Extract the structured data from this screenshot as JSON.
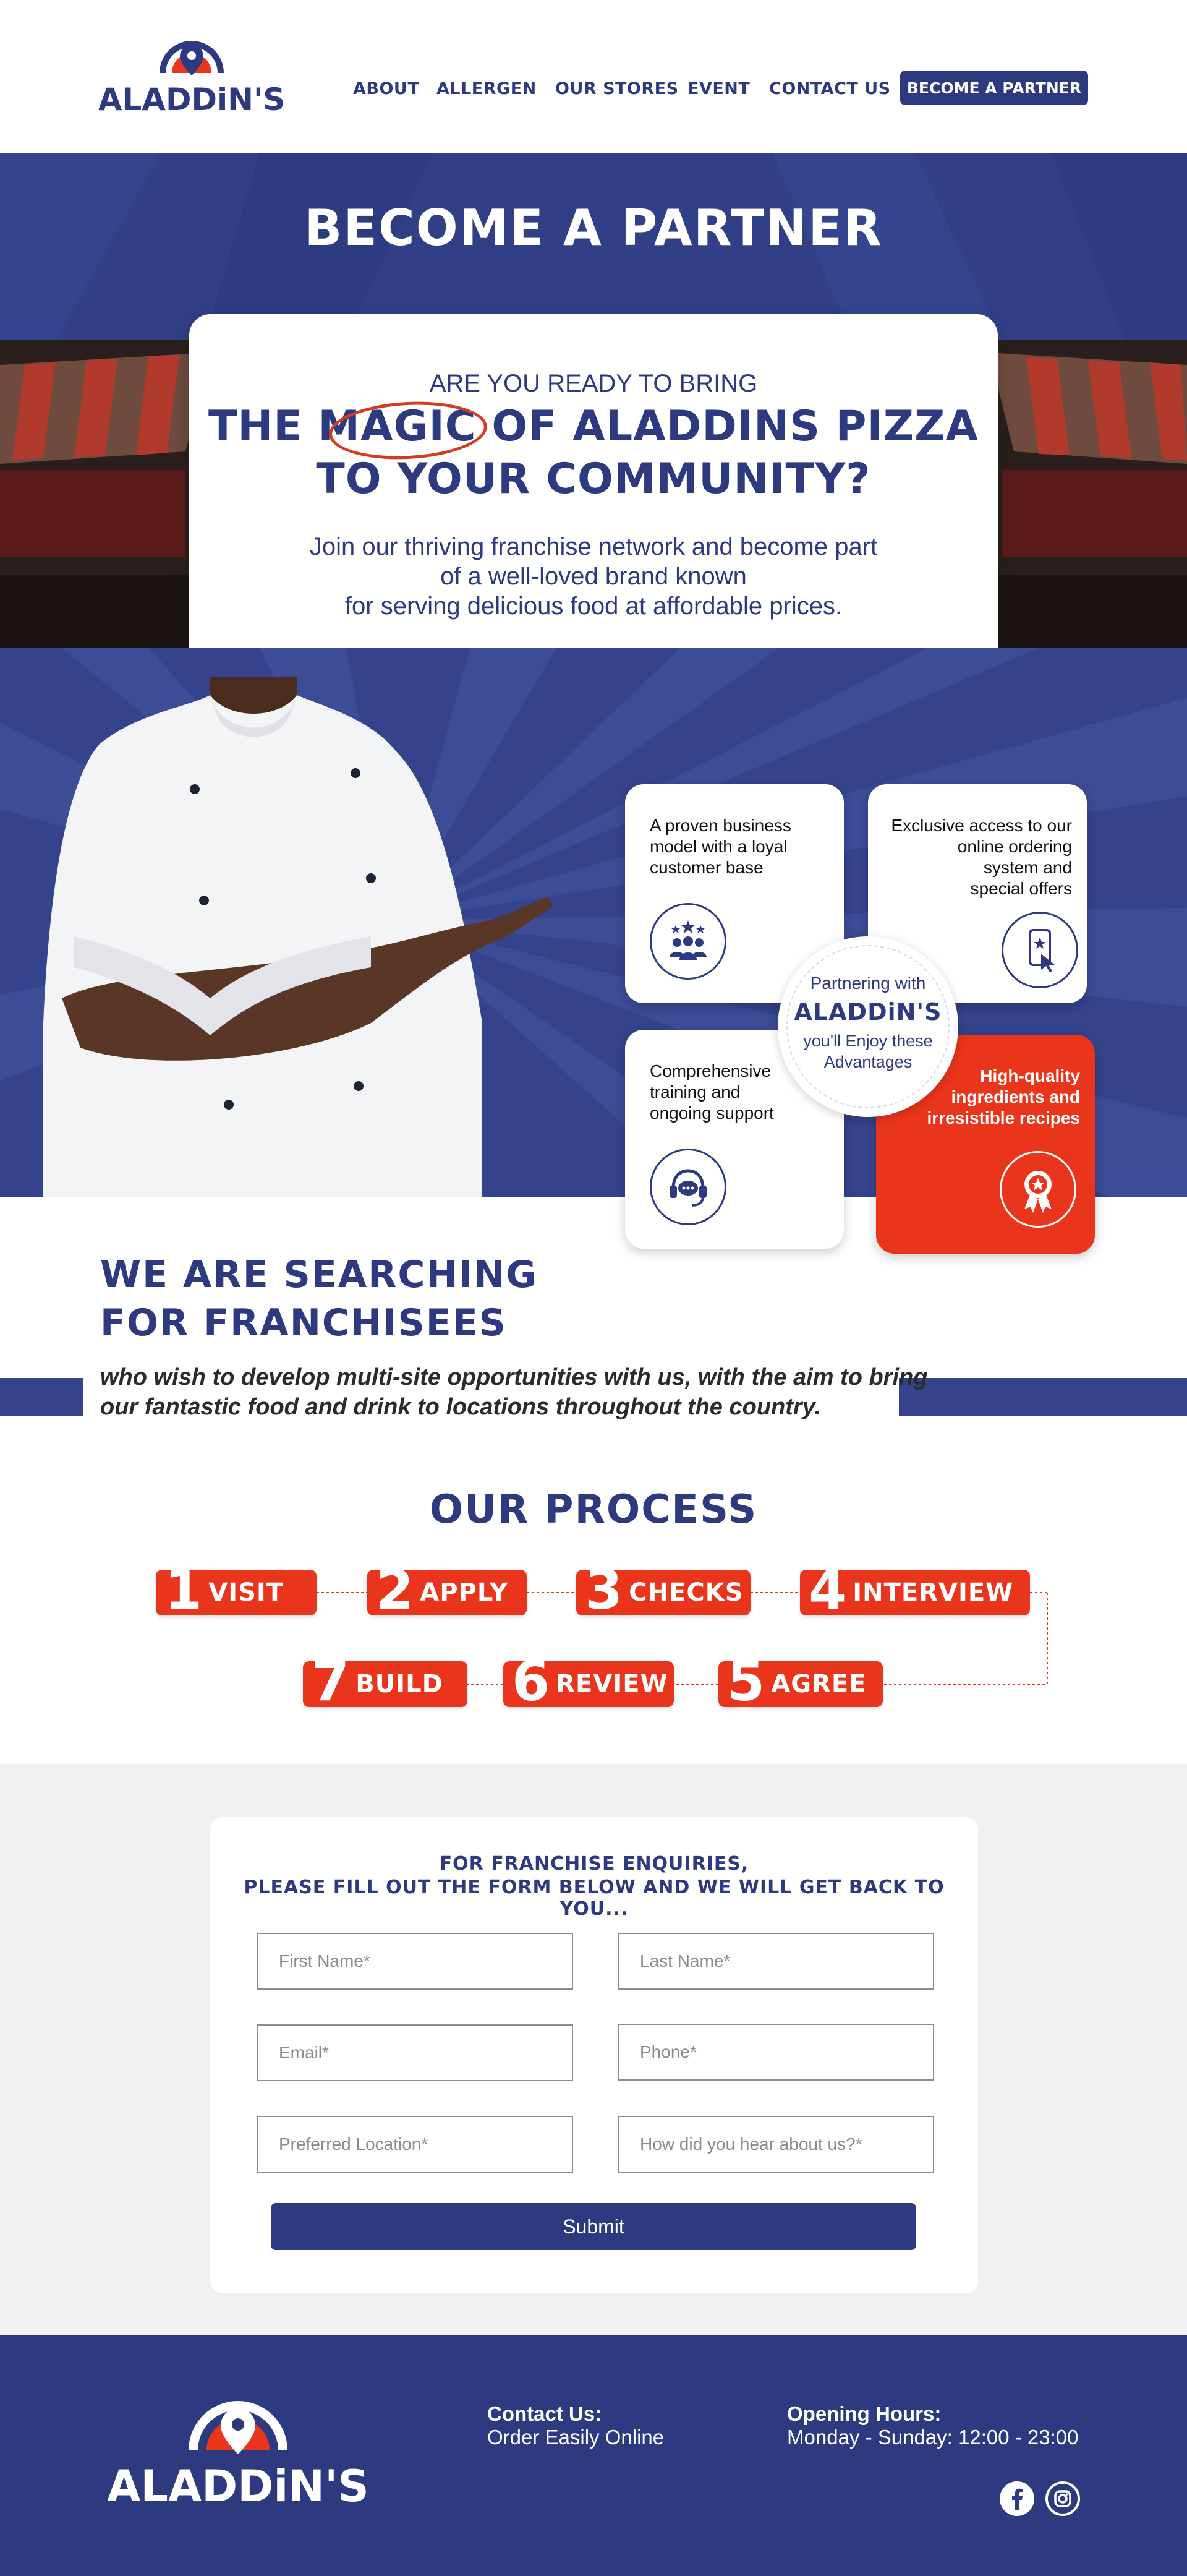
{
  "brand": {
    "name": "ALADDiN'S",
    "colors": {
      "navy": "#2e3a7f",
      "red": "#e8351b",
      "light_gray": "#f0f0f0"
    }
  },
  "nav": {
    "items": [
      {
        "label": "ABOUT"
      },
      {
        "label": "ALLERGEN"
      },
      {
        "label": "OUR STORES"
      },
      {
        "label": "EVENT"
      },
      {
        "label": "CONTACT US"
      }
    ],
    "cta": "BECOME A PARTNER"
  },
  "hero": {
    "title": "BECOME A PARTNER",
    "kicker": "ARE YOU READY TO BRING",
    "headline_line1": "THE MAGIC OF ALADDINS PIZZA",
    "headline_line2": "TO YOUR COMMUNITY?",
    "body_lines": [
      "Join our thriving franchise network and become part",
      "of a well-loved brand known",
      "for serving delicious food at affordable prices."
    ]
  },
  "advantages": {
    "badge_line1": "Partnering with",
    "badge_brand": "ALADDiN'S",
    "badge_line3": "you'll Enjoy these Advantages",
    "cards": [
      {
        "lines": [
          "A proven business",
          "model with a loyal",
          "customer base"
        ],
        "icon": "people-stars-icon"
      },
      {
        "lines": [
          "Exclusive access to our",
          "online ordering",
          "system and",
          "special offers"
        ],
        "icon": "phone-ordering-icon"
      },
      {
        "lines": [
          "Comprehensive",
          "training and",
          "ongoing support"
        ],
        "icon": "support-headset-icon"
      },
      {
        "lines": [
          "High-quality",
          "ingredients and",
          "irresistible recipes"
        ],
        "icon": "award-ribbon-icon"
      }
    ]
  },
  "franchise": {
    "title_line1": "WE ARE SEARCHING",
    "title_line2": "FOR FRANCHISEES",
    "sub_line1": "who wish to develop multi-site opportunities with us, with the aim to bring",
    "sub_line2": "our fantastic food and drink to locations throughout the country."
  },
  "process": {
    "title": "OUR PROCESS",
    "steps": [
      {
        "num": "1",
        "label": "VISIT"
      },
      {
        "num": "2",
        "label": "APPLY"
      },
      {
        "num": "3",
        "label": "CHECKS"
      },
      {
        "num": "4",
        "label": "INTERVIEW"
      },
      {
        "num": "5",
        "label": "AGREE"
      },
      {
        "num": "6",
        "label": "REVIEW"
      },
      {
        "num": "7",
        "label": "BUILD"
      }
    ]
  },
  "form": {
    "heading_line1": "FOR FRANCHISE ENQUIRIES,",
    "heading_line2": "PLEASE FILL OUT THE FORM BELOW AND WE WILL GET BACK TO YOU...",
    "fields": {
      "first_name": {
        "placeholder": "First Name*",
        "value": ""
      },
      "last_name": {
        "placeholder": "Last Name*",
        "value": ""
      },
      "email": {
        "placeholder": "Email*",
        "value": ""
      },
      "phone": {
        "placeholder": "Phone*",
        "value": ""
      },
      "location": {
        "placeholder": "Preferred Location*",
        "value": ""
      },
      "source": {
        "placeholder": "How did you hear about us?*",
        "value": ""
      }
    },
    "submit": "Submit"
  },
  "footer": {
    "contact_heading": "Contact Us:",
    "contact_text": "Order Easily Online",
    "hours_heading": "Opening Hours:",
    "hours_text": "Monday - Sunday: 12:00 - 23:00",
    "social": [
      "facebook-icon",
      "instagram-icon"
    ]
  }
}
